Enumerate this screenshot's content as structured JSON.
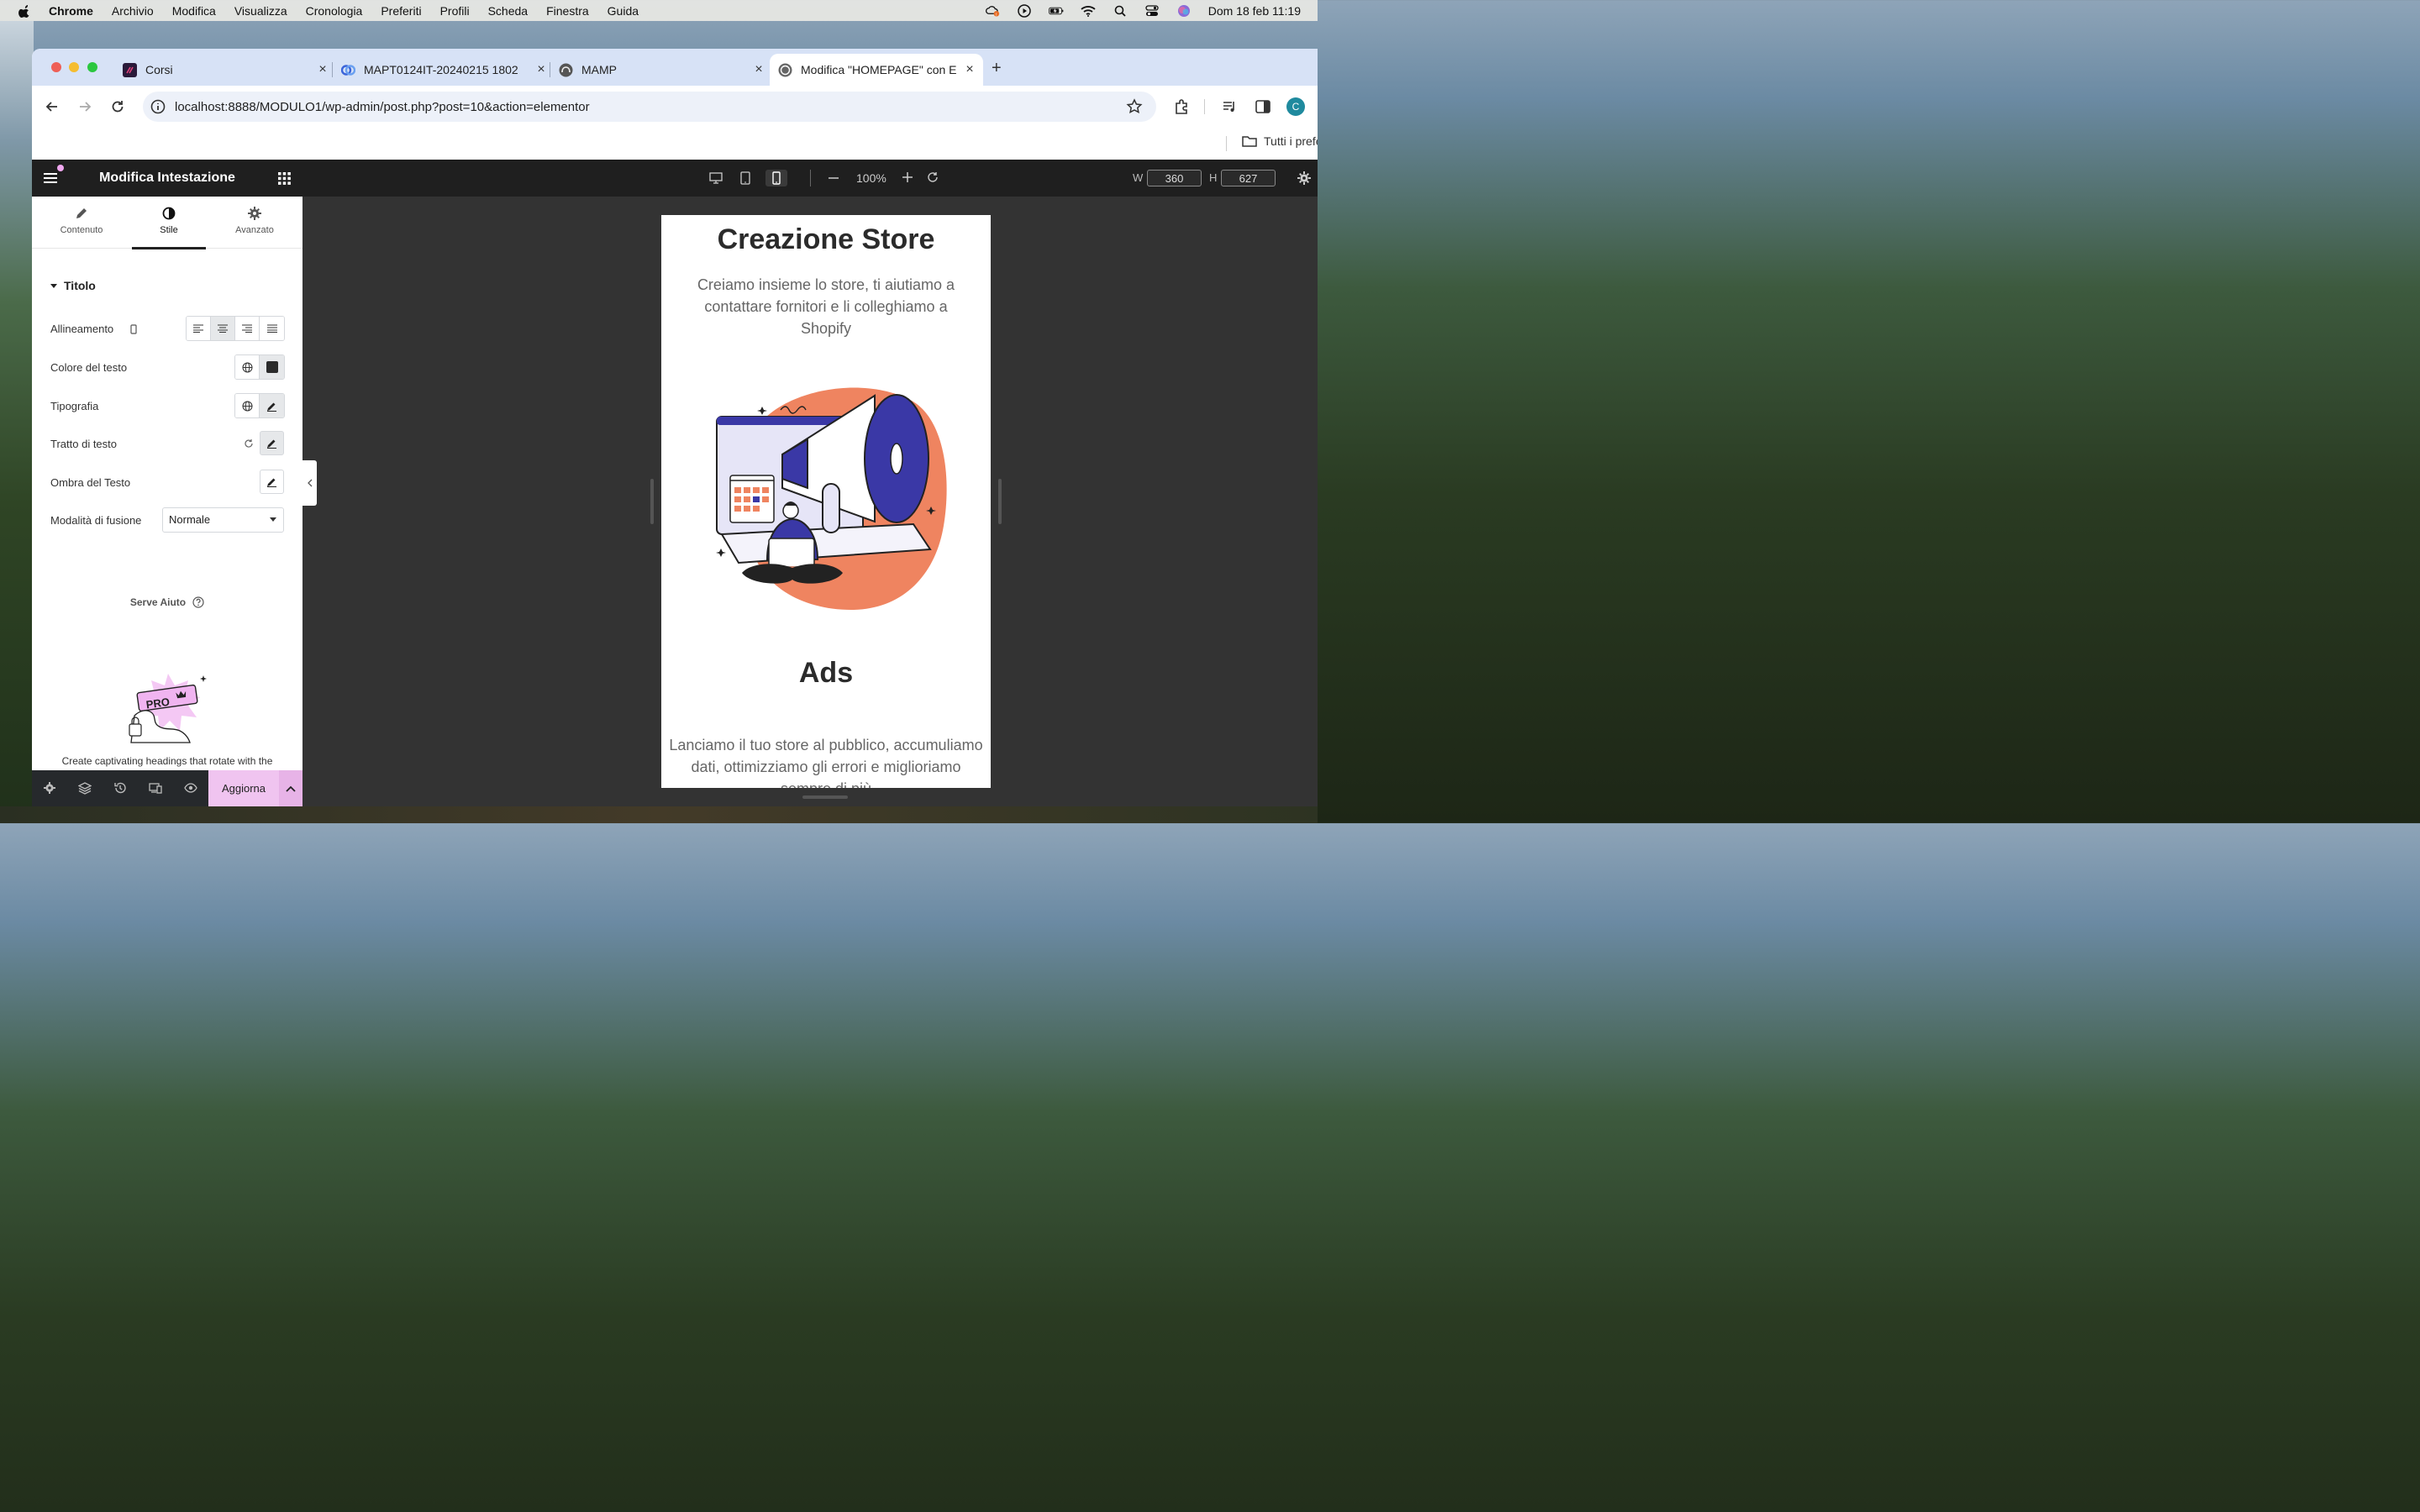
{
  "menubar": {
    "app": "Chrome",
    "items": [
      "Archivio",
      "Modifica",
      "Visualizza",
      "Cronologia",
      "Preferiti",
      "Profili",
      "Scheda",
      "Finestra",
      "Guida"
    ],
    "clock": "Dom 18 feb  11:19"
  },
  "tabs": [
    {
      "title": "Corsi"
    },
    {
      "title": "MAPT0124IT-20240215 1802"
    },
    {
      "title": "MAMP"
    },
    {
      "title": "Modifica \"HOMEPAGE\" con El"
    }
  ],
  "address": {
    "url": "localhost:8888/MODULO1/wp-admin/post.php?post=10&action=elementor"
  },
  "profile_initial": "C",
  "bookmarks": {
    "folder": "Tutti i prefe"
  },
  "panel": {
    "title": "Modifica Intestazione",
    "tabs": [
      "Contenuto",
      "Stile",
      "Avanzato"
    ],
    "section": "Titolo",
    "controls": {
      "alignment": "Allineamento",
      "text_color": "Colore del testo",
      "typography": "Tipografia",
      "text_stroke": "Tratto di testo",
      "text_shadow": "Ombra del Testo",
      "blend_mode": "Modalità di fusione",
      "blend_value": "Normale"
    },
    "help": "Serve Aiuto",
    "promo_badge": "PRO",
    "promo_text": "Create captivating headings that rotate with the",
    "footer": {
      "update": "Aggiorna"
    }
  },
  "topbar": {
    "zoom": "100%",
    "w_label": "W",
    "w_value": "360",
    "h_label": "H",
    "h_value": "627"
  },
  "canvas": {
    "heading1": "Creazione Store",
    "text1": "Creiamo insieme lo store, ti aiutiamo a contattare fornitori e li colleghiamo a Shopify",
    "heading2": "Ads",
    "text2": "Lanciamo il tuo store al pubblico, accumuliamo dati, ottimizziamo gli errori e miglioriamo sempre di più"
  },
  "colors": {
    "accent_pink": "#f0c4f0",
    "editor_dark": "#1f1f1f",
    "canvas_bg": "#333333",
    "illus_orange": "#ef8460",
    "illus_blue": "#3a38a6"
  }
}
